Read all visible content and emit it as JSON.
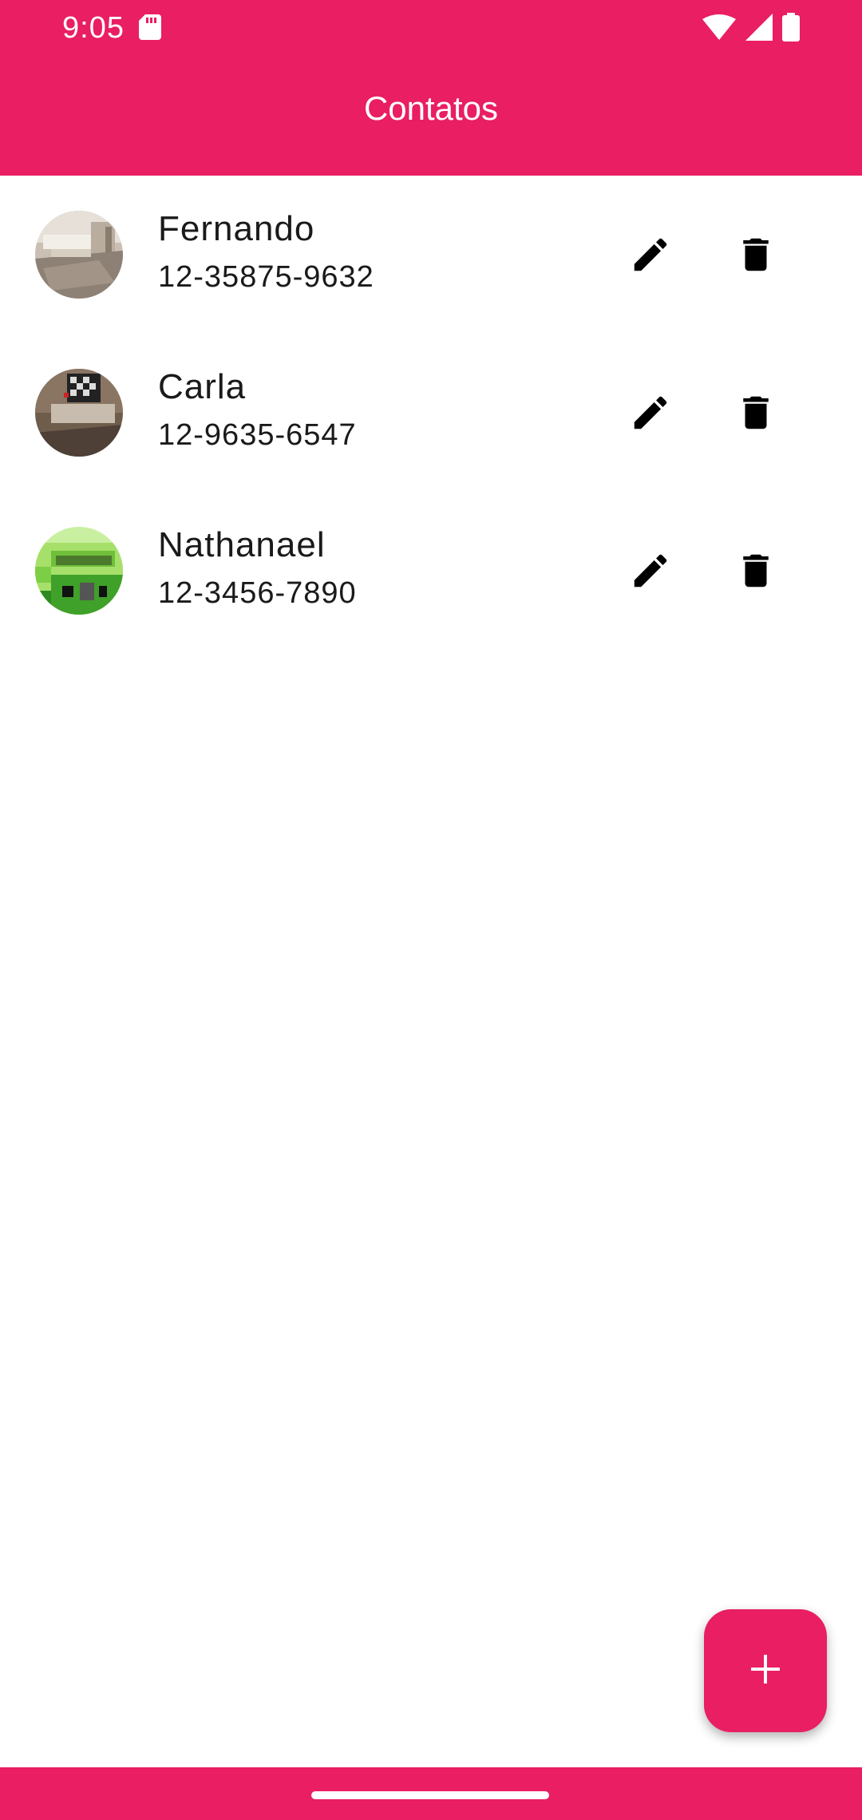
{
  "status_bar": {
    "time": "9:05",
    "icons": [
      "sd-card-icon",
      "wifi-icon",
      "signal-icon",
      "battery-icon"
    ]
  },
  "app_bar": {
    "title": "Contatos",
    "color": "#E91E63"
  },
  "contacts": [
    {
      "name": "Fernando",
      "phone": "12-35875-9632",
      "avatar": "room-photo"
    },
    {
      "name": "Carla",
      "phone": "12-9635-6547",
      "avatar": "room-photo-dark"
    },
    {
      "name": "Nathanael",
      "phone": "12-3456-7890",
      "avatar": "green-pixel-art"
    }
  ],
  "actions": {
    "edit_icon": "pencil-icon",
    "delete_icon": "trash-icon"
  },
  "fab": {
    "icon": "plus-icon"
  }
}
